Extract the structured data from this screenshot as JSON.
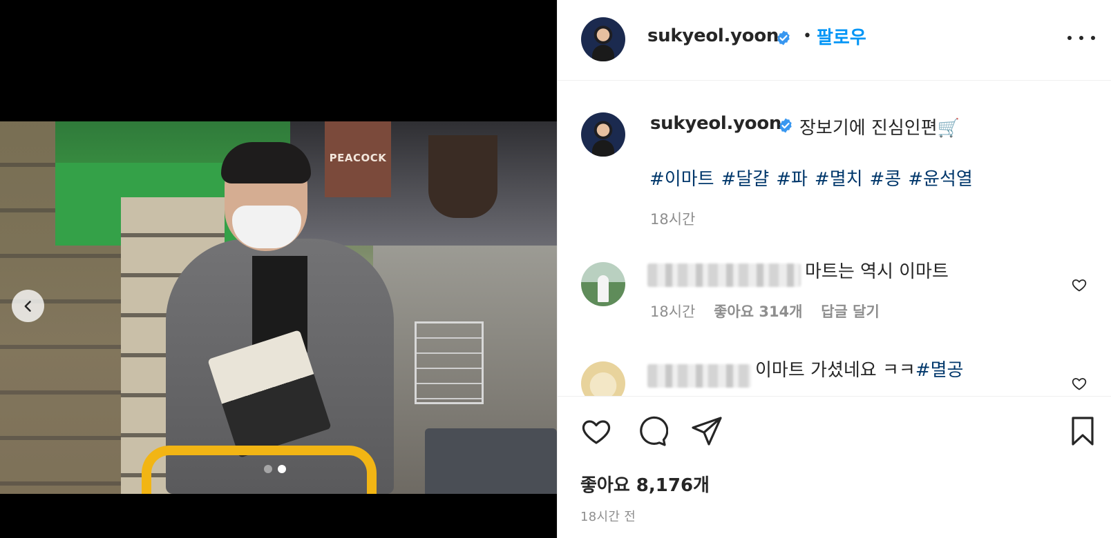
{
  "post": {
    "author": "sukyeol.yoon",
    "follow_label": "팔로우",
    "separator": "•",
    "caption": "장보기에 진심인편🛒",
    "hashtags": [
      "#이마트",
      "#달걀",
      "#파",
      "#멸치",
      "#콩",
      "#윤석열"
    ],
    "caption_time": "18시간",
    "likes": "좋아요 8,176개",
    "time_ago": "18시간 전",
    "photo_sign": "PEACOCK",
    "carousel": {
      "total": 2,
      "active_index": 1
    }
  },
  "comments": [
    {
      "text": "마트는 역시 이마트",
      "time": "18시간",
      "likes": "좋아요 314개",
      "reply_label": "답글 달기"
    },
    {
      "text": "이마트 가셨네요 ㅋㅋ",
      "tag": "#멸공"
    }
  ],
  "icons": {
    "verified": "verified-badge-icon",
    "more": "more-options-icon",
    "heart": "heart-icon",
    "comment": "comment-bubble-icon",
    "share": "paper-plane-icon",
    "save": "bookmark-icon",
    "prev": "chevron-left-icon"
  },
  "colors": {
    "link_blue": "#0095f6",
    "hashtag": "#00376b",
    "verified": "#3897f0",
    "muted": "#8e8e8e"
  }
}
